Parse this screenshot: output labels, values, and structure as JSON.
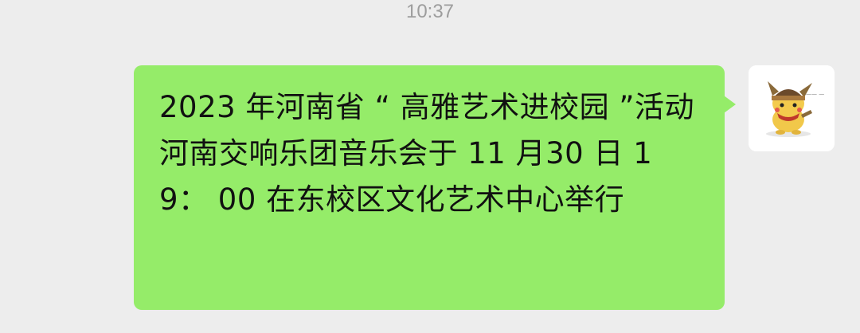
{
  "chat": {
    "timestamp": "10:37",
    "messages": [
      {
        "sender": "me",
        "text": "2023 年河南省 “ 高雅艺术进校园 ”活动河南交响乐团音乐会于 11 月30 日 19： 00 在东校区文化艺术中心举行",
        "bubble_color": "#95ec69",
        "avatar_icon": "pikachu-cartoon-avatar"
      }
    ]
  }
}
